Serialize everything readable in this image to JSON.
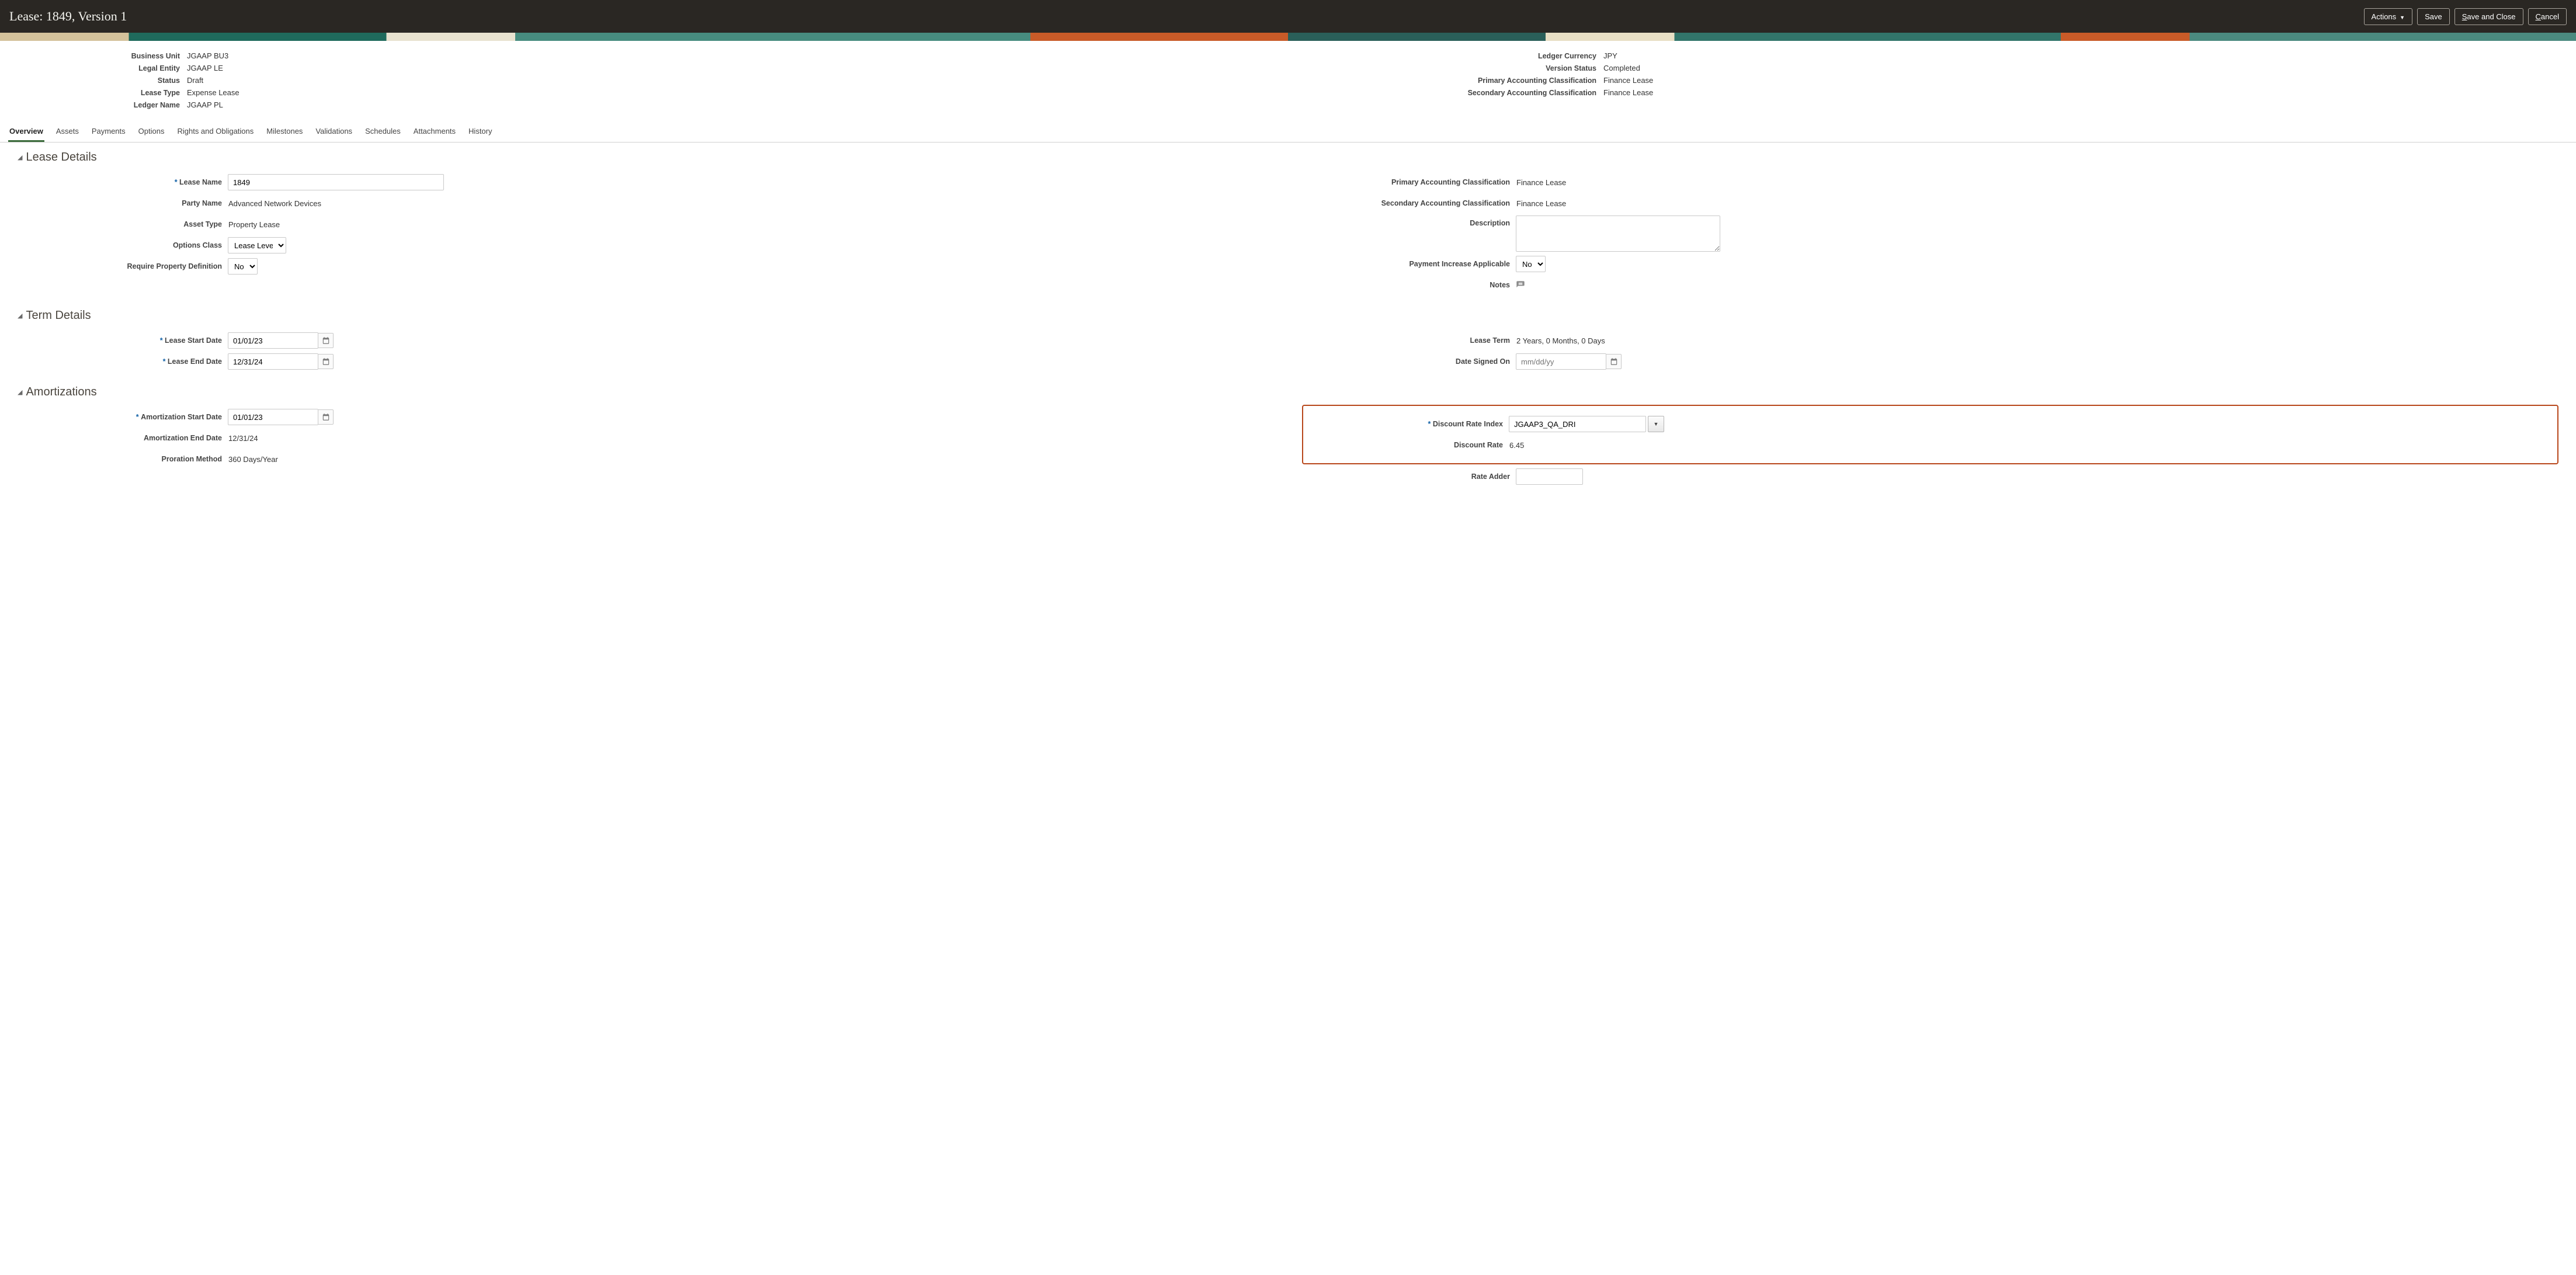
{
  "header": {
    "title": "Lease: 1849, Version 1",
    "actions_label": "Actions",
    "save_label": "Save",
    "save_close_prefix": "S",
    "save_close_rest": "ave and Close",
    "cancel_prefix": "C",
    "cancel_rest": "ancel"
  },
  "summary": {
    "left": {
      "business_unit_label": "Business Unit",
      "business_unit_value": "JGAAP BU3",
      "legal_entity_label": "Legal Entity",
      "legal_entity_value": "JGAAP LE",
      "status_label": "Status",
      "status_value": "Draft",
      "lease_type_label": "Lease Type",
      "lease_type_value": "Expense Lease",
      "ledger_name_label": "Ledger Name",
      "ledger_name_value": "JGAAP PL"
    },
    "right": {
      "ledger_currency_label": "Ledger Currency",
      "ledger_currency_value": "JPY",
      "version_status_label": "Version Status",
      "version_status_value": "Completed",
      "primary_acc_label": "Primary Accounting Classification",
      "primary_acc_value": "Finance Lease",
      "secondary_acc_label": "Secondary Accounting Classification",
      "secondary_acc_value": "Finance Lease"
    }
  },
  "tabs": {
    "overview": "Overview",
    "assets": "Assets",
    "payments": "Payments",
    "options": "Options",
    "rights": "Rights and Obligations",
    "milestones": "Milestones",
    "validations": "Validations",
    "schedules": "Schedules",
    "attachments": "Attachments",
    "history": "History"
  },
  "sections": {
    "lease_details": "Lease Details",
    "term_details": "Term Details",
    "amortizations": "Amortizations"
  },
  "lease_details": {
    "lease_name_label": "Lease Name",
    "lease_name_value": "1849",
    "party_name_label": "Party Name",
    "party_name_value": "Advanced Network Devices",
    "asset_type_label": "Asset Type",
    "asset_type_value": "Property Lease",
    "options_class_label": "Options Class",
    "options_class_value": "Lease Level",
    "require_prop_label": "Require Property Definition",
    "require_prop_value": "No",
    "primary_class_label": "Primary Accounting Classification",
    "primary_class_value": "Finance Lease",
    "secondary_class_label": "Secondary Accounting Classification",
    "secondary_class_value": "Finance Lease",
    "description_label": "Description",
    "payment_increase_label": "Payment Increase Applicable",
    "payment_increase_value": "No",
    "notes_label": "Notes"
  },
  "term_details": {
    "lease_start_label": "Lease Start Date",
    "lease_start_value": "01/01/23",
    "lease_end_label": "Lease End Date",
    "lease_end_value": "12/31/24",
    "lease_term_label": "Lease Term",
    "lease_term_value": "2 Years, 0 Months, 0 Days",
    "date_signed_label": "Date Signed On",
    "date_signed_placeholder": "mm/dd/yy"
  },
  "amortizations": {
    "amort_start_label": "Amortization Start Date",
    "amort_start_value": "01/01/23",
    "amort_end_label": "Amortization End Date",
    "amort_end_value": "12/31/24",
    "proration_label": "Proration Method",
    "proration_value": "360 Days/Year",
    "discount_index_label": "Discount Rate Index",
    "discount_index_value": "JGAAP3_QA_DRI",
    "discount_rate_label": "Discount Rate",
    "discount_rate_value": "6.45",
    "rate_adder_label": "Rate Adder"
  }
}
